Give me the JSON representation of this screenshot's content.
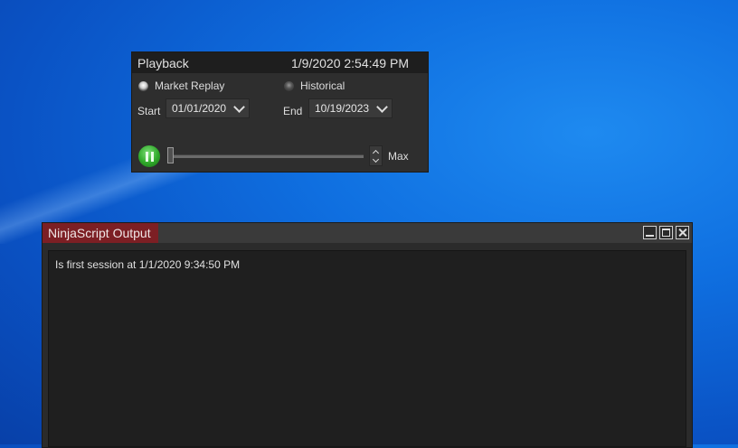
{
  "playback": {
    "title": "Playback",
    "time": "1/9/2020 2:54:49 PM",
    "mode_market_replay": "Market Replay",
    "mode_historical": "Historical",
    "start_label": "Start",
    "start_date": "01/01/2020",
    "end_label": "End",
    "end_date": "10/19/2023",
    "speed_label": "Max",
    "selected_mode": "Market Replay"
  },
  "output": {
    "title": "NinjaScript Output",
    "lines": [
      "Is first session at 1/1/2020 9:34:50 PM"
    ]
  },
  "colors": {
    "output_tab": "#7c1f24",
    "play_button": "#2fa82a",
    "desktop": "#0f6fe0"
  }
}
